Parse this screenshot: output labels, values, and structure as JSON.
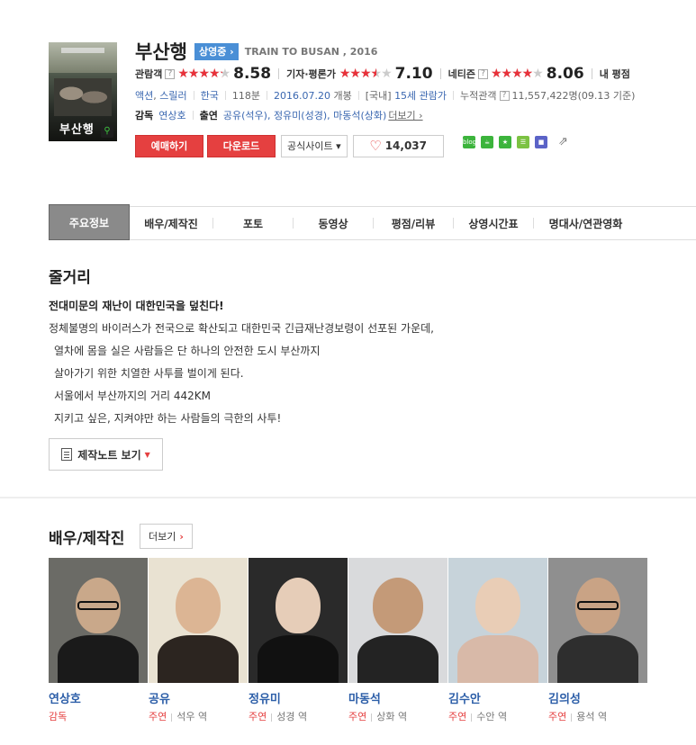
{
  "movie": {
    "poster_title": "부산행",
    "title": "부산행",
    "status_badge": "상영중 ›",
    "eng_title": "TRAIN TO BUSAN , 2016"
  },
  "ratings": [
    {
      "label": "관람객",
      "help": "?",
      "stars": 4.29,
      "score": "8.58"
    },
    {
      "label": "기자·평론가",
      "help": "",
      "stars": 3.55,
      "score": "7.10"
    },
    {
      "label": "네티즌",
      "help": "?",
      "stars": 4.03,
      "score": "8.06"
    },
    {
      "label": "내 평점",
      "help": "",
      "stars": 0,
      "score": ""
    }
  ],
  "info": {
    "genre1": "액션",
    "genre2": "스릴러",
    "country": "한국",
    "runtime": "118분",
    "release_date": "2016.07.20",
    "release_suffix": "개봉",
    "grade_prefix": "[국내]",
    "grade": "15세 관람가",
    "audience_label": "누적관객",
    "audience_value": "11,557,422명(09.13 기준)"
  },
  "credits": {
    "director_label": "감독",
    "director": "연상호",
    "cast_label": "출연",
    "cast_items": [
      "공유(석우),",
      "정유미(성경),",
      "마동석(상화)"
    ],
    "more": "더보기 ›"
  },
  "buttons": {
    "reserve": "예매하기",
    "download": "다운로드",
    "official_site": "공식사이트 ▾",
    "like_count": "14,037"
  },
  "share": {
    "icons": [
      {
        "name": "blog-share-icon",
        "label": "blog",
        "color": "#3cb43c"
      },
      {
        "name": "cafe-share-icon",
        "label": "☕",
        "color": "#3cb43c"
      },
      {
        "name": "star-share-icon",
        "label": "★",
        "color": "#3cb43c"
      },
      {
        "name": "band-share-icon",
        "label": "☰",
        "color": "#7cc242"
      },
      {
        "name": "memo-share-icon",
        "label": "■",
        "color": "#5b63c7"
      }
    ],
    "open_label": "⇗"
  },
  "tabs": [
    "주요정보",
    "배우/제작진",
    "포토",
    "동영상",
    "평점/리뷰",
    "상영시간표",
    "명대사/연관영화"
  ],
  "synopsis": {
    "title": "줄거리",
    "lead": "전대미문의 재난이 대한민국을 덮친다!",
    "lines": [
      "정체불명의 바이러스가 전국으로 확산되고 대한민국 긴급재난경보령이 선포된 가운데,",
      "열차에 몸을 실은 사람들은 단 하나의 안전한 도시 부산까지",
      "살아가기 위한 치열한 사투를 벌이게 된다.",
      "서울에서 부산까지의 거리 442KM",
      "지키고 싶은, 지켜야만 하는 사람들의 극한의 사투!"
    ],
    "note_button": "제작노트 보기"
  },
  "cast_section": {
    "title": "배우/제작진",
    "more": "더보기",
    "people": [
      {
        "name": "연상호",
        "type": "감독",
        "role": ""
      },
      {
        "name": "공유",
        "type": "주연",
        "role": "석우 역"
      },
      {
        "name": "정유미",
        "type": "주연",
        "role": "성경 역"
      },
      {
        "name": "마동석",
        "type": "주연",
        "role": "상화 역"
      },
      {
        "name": "김수안",
        "type": "주연",
        "role": "수안 역"
      },
      {
        "name": "김의성",
        "type": "주연",
        "role": "용석 역"
      }
    ]
  },
  "colors": {
    "accent_red": "#e54040",
    "link_blue": "#3a67b0",
    "name_blue": "#2c5ea8",
    "badge_blue": "#4a8fd6",
    "active_tab": "#8a8a8a"
  }
}
